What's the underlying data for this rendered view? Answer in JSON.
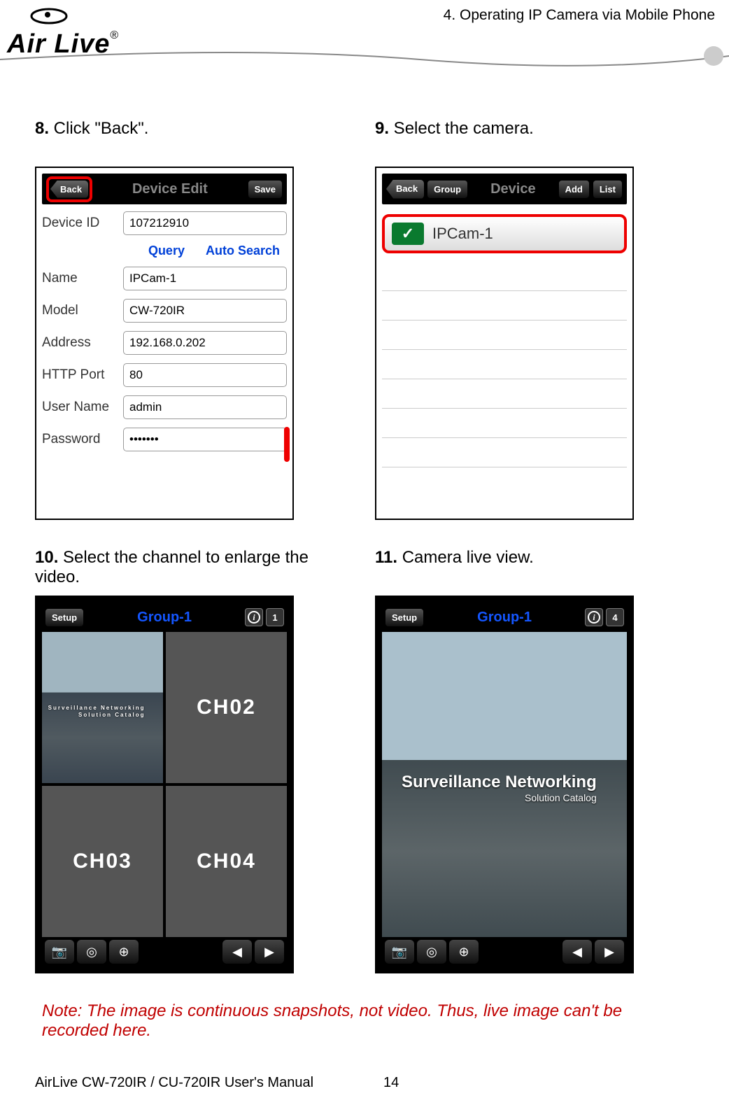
{
  "header": {
    "logo_text": "Air Live",
    "logo_reg": "®",
    "breadcrumb": "4. Operating IP Camera via Mobile Phone"
  },
  "step8": {
    "num": "8.",
    "caption": " Click \"Back\".",
    "topbar": {
      "back": "Back",
      "title": "Device Edit",
      "save": "Save"
    },
    "device_id_label": "Device ID",
    "device_id_value": "107212910",
    "query": "Query",
    "auto_search": "Auto Search",
    "name_label": "Name",
    "name_value": "IPCam-1",
    "model_label": "Model",
    "model_value": "CW-720IR",
    "address_label": "Address",
    "address_value": "192.168.0.202",
    "port_label": "HTTP Port",
    "port_value": "80",
    "user_label": "User Name",
    "user_value": "admin",
    "pass_label": "Password",
    "pass_value": "•••••••"
  },
  "step9": {
    "num": "9.",
    "caption": " Select the camera.",
    "topbar": {
      "back": "Back",
      "group": "Group",
      "title": "Device",
      "add": "Add",
      "list": "List"
    },
    "camera_name": "IPCam-1"
  },
  "step10": {
    "num": "10.",
    "caption": " Select the channel to enlarge the video.",
    "title": "Group-1",
    "ch02": "CH02",
    "ch03": "CH03",
    "ch04": "CH04",
    "live_small_l1": "Surveillance Networking",
    "live_small_l2": "Solution Catalog",
    "layout_num": "1"
  },
  "step11": {
    "num": "11.",
    "caption": " Camera live view.",
    "title": "Group-1",
    "live_l1": "Surveillance Networking",
    "live_l2": "Solution Catalog",
    "layout_num": "4"
  },
  "note": "Note: The image is continuous snapshots, not video. Thus, live image can't be recorded here.",
  "footer": {
    "manual": "AirLive CW-720IR / CU-720IR User's Manual",
    "page": "14"
  }
}
